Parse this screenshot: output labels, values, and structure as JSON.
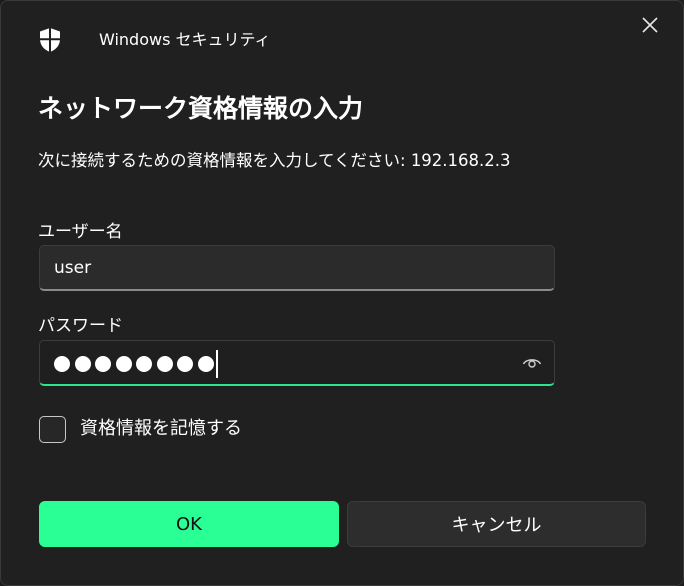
{
  "window": {
    "app_title": "Windows セキュリティ",
    "icon": "shield-icon",
    "close_icon": "close-icon"
  },
  "dialog": {
    "heading": "ネットワーク資格情報の入力",
    "description": "次に接続するための資格情報を入力してください: 192.168.2.3"
  },
  "username": {
    "label": "ユーザー名",
    "value": "user"
  },
  "password": {
    "label": "パスワード",
    "masked_length": 8,
    "reveal_icon": "eye-icon"
  },
  "remember": {
    "label": "資格情報を記憶する",
    "checked": false
  },
  "buttons": {
    "ok_label": "OK",
    "cancel_label": "キャンセル"
  },
  "colors": {
    "accent": "#2aff95",
    "focus_underline": "#2ee58f",
    "background": "#202020"
  }
}
